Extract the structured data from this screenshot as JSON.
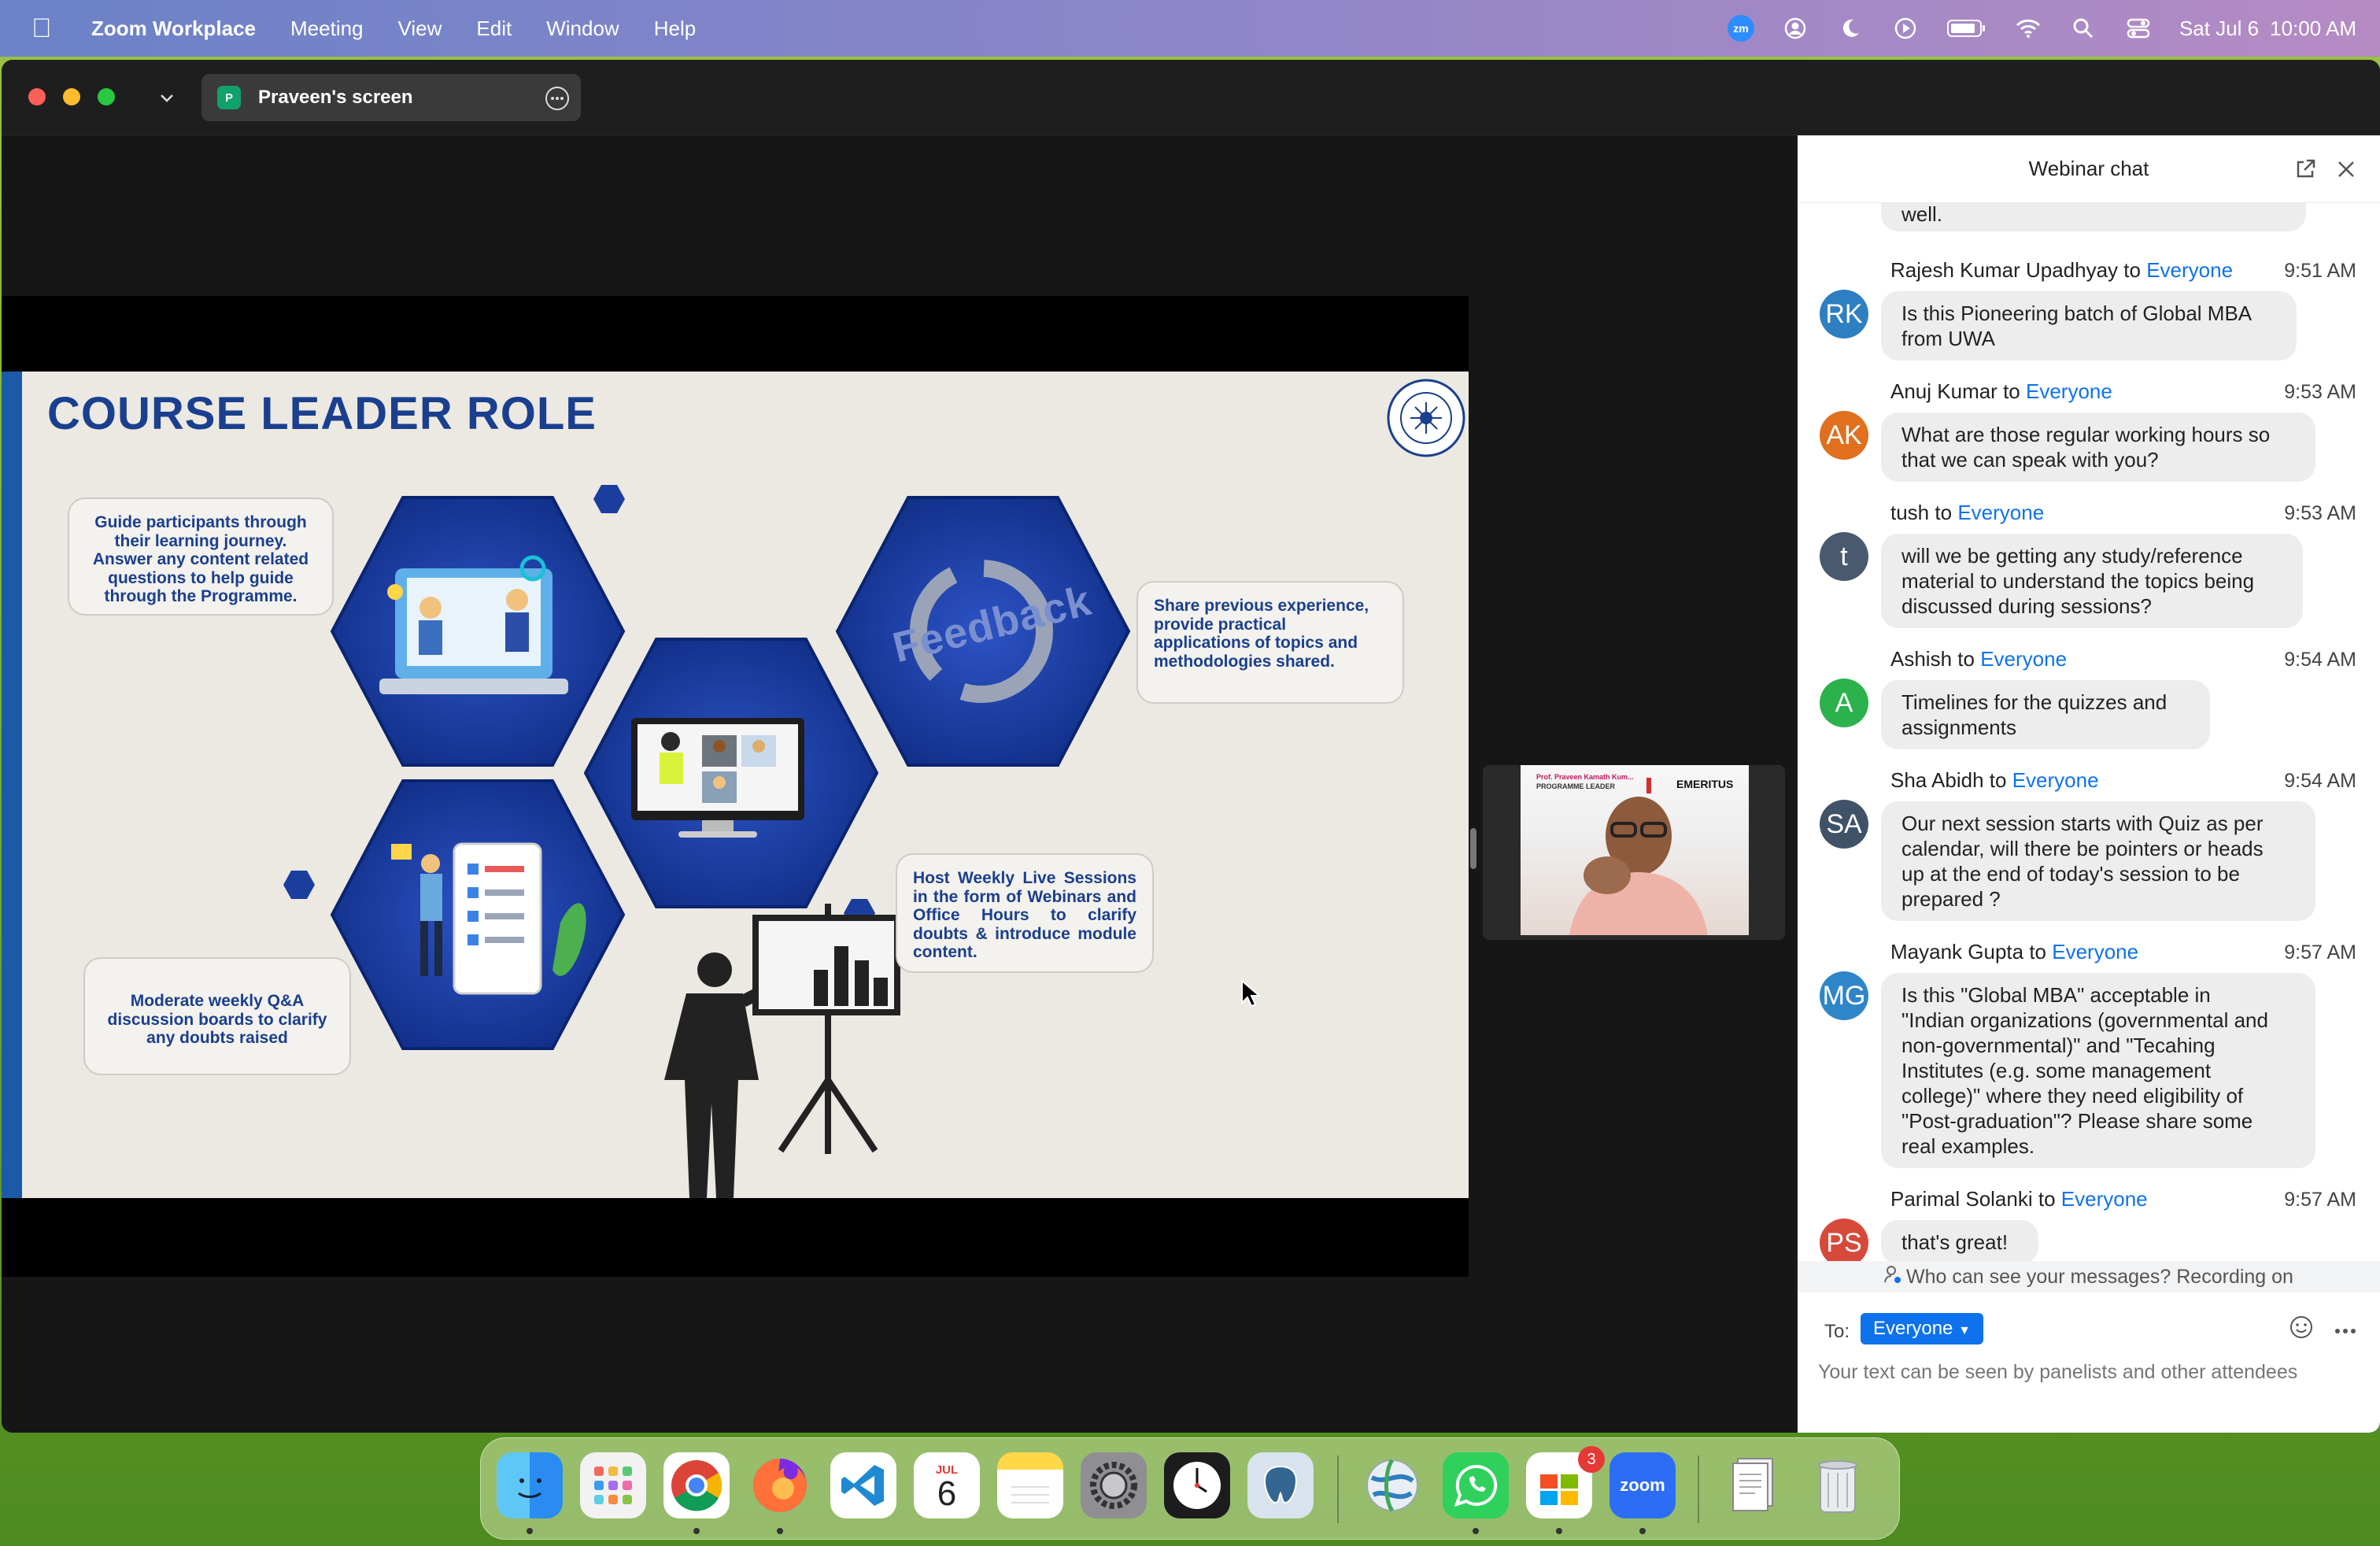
{
  "menubar": {
    "app_name": "Zoom Workplace",
    "items": [
      "Meeting",
      "View",
      "Edit",
      "Window",
      "Help"
    ],
    "date": "Sat Jul 6",
    "time": "10:00 AM",
    "zoom_badge": "zm"
  },
  "window": {
    "screen_share_label": "Praveen's screen",
    "screen_share_badge": "P"
  },
  "slide": {
    "title": "COURSE LEADER ROLE",
    "bubbles": [
      "Guide participants through their learning journey. Answer any content related questions to help guide through the Programme.",
      "Share previous experience, provide practical applications of topics and methodologies shared.",
      "Host Weekly Live Sessions in the form of Webinars and Office Hours to clarify doubts & introduce module content.",
      "Moderate weekly Q&A discussion boards to clarify any doubts raised"
    ],
    "feedback_word": "Feedback"
  },
  "video": {
    "caption_name": "Prof. Praveen Kamath Kum...",
    "caption_role": "PROGRAMME LEADER",
    "brand": "EMERITUS"
  },
  "chat": {
    "title": "Webinar chat",
    "partial_prev_text": "well.",
    "messages": [
      {
        "sender": "Rajesh Kumar Upadhyay",
        "to_word": "to",
        "recipient": "Everyone",
        "time": "9:51 AM",
        "initials": "RK",
        "color": "#2e7fc1",
        "lines": [
          "Is this Pioneering batch of Global MBA",
          "from UWA"
        ]
      },
      {
        "sender": "Anuj Kumar",
        "to_word": "to",
        "recipient": "Everyone",
        "time": "9:53 AM",
        "initials": "AK",
        "color": "#e0701d",
        "lines": [
          "What are those regular working hours so",
          "that we can speak with you?"
        ]
      },
      {
        "sender": "tush",
        "to_word": "to",
        "recipient": "Everyone",
        "time": "9:53 AM",
        "initials": "t",
        "color": "#4a5a6e",
        "lines": [
          "will we be getting any study/reference",
          "material to understand the topics being",
          "discussed during sessions?"
        ]
      },
      {
        "sender": "Ashish",
        "to_word": "to",
        "recipient": "Everyone",
        "time": "9:54 AM",
        "initials": "A",
        "color": "#2bb24c",
        "lines": [
          "Timelines for the quizzes and",
          "assignments"
        ]
      },
      {
        "sender": "Sha Abidh",
        "to_word": "to",
        "recipient": "Everyone",
        "time": "9:54 AM",
        "initials": "SA",
        "color": "#3f5268",
        "lines": [
          "Our next session starts with Quiz as per",
          "calendar, will there be pointers or heads",
          "up at the end of today's session to be",
          "prepared ?"
        ]
      },
      {
        "sender": "Mayank Gupta",
        "to_word": "to",
        "recipient": "Everyone",
        "time": "9:57 AM",
        "initials": "MG",
        "color": "#2e86c8",
        "lines": [
          "Is this \"Global MBA\" acceptable in",
          "\"Indian organizations (governmental and",
          "non-governmental)\" and \"Tecahing",
          "Institutes (e.g. some management",
          "college)\" where they need eligibility of",
          "\"Post-graduation\"? Please share some",
          "real examples."
        ]
      },
      {
        "sender": "Parimal Solanki",
        "to_word": "to",
        "recipient": "Everyone",
        "time": "9:57 AM",
        "initials": "PS",
        "color": "#d6493b",
        "lines": [
          "that's great!"
        ]
      }
    ],
    "notice": "Who can see your messages? Recording on",
    "to_label": "To:",
    "to_value": "Everyone",
    "input_placeholder": "Your text can be seen by panelists and other attendees"
  },
  "dock": {
    "calendar_month": "JUL",
    "calendar_day": "6",
    "zoom_label": "zoom",
    "badge_count": "3"
  }
}
